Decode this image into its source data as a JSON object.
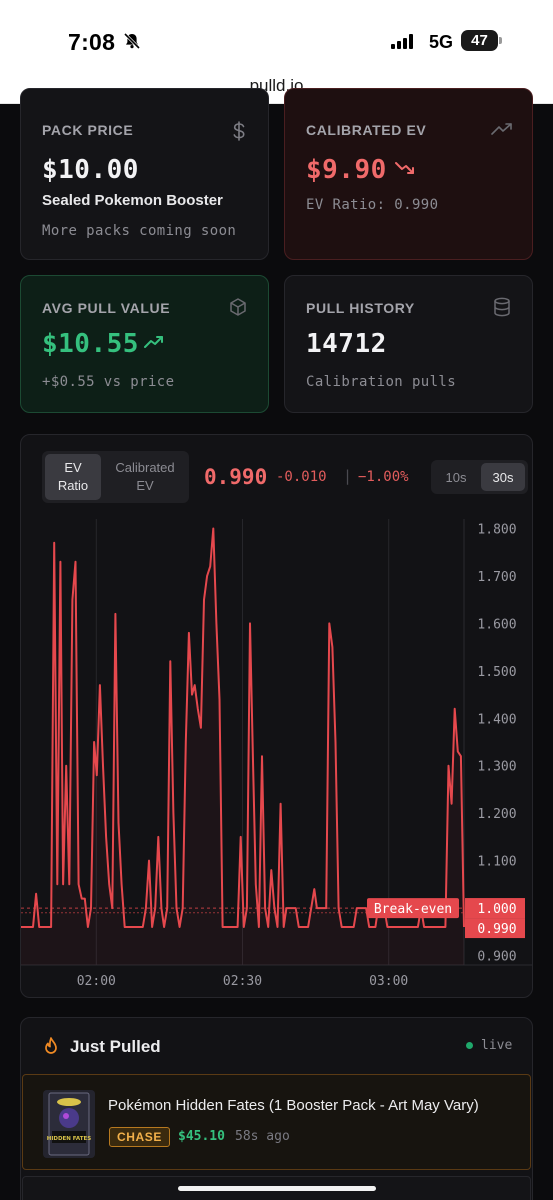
{
  "status_bar": {
    "time": "7:08",
    "network": "5G",
    "battery": "47"
  },
  "browser": {
    "url": "pulld.io"
  },
  "cards": {
    "pack_price": {
      "label": "PACK PRICE",
      "value": "$10.00",
      "product": "Sealed Pokemon Booster",
      "note": "More packs coming soon",
      "icon": "dollar-icon"
    },
    "calibrated_ev": {
      "label": "CALIBRATED EV",
      "value": "$9.90",
      "ratio": "EV Ratio: 0.990",
      "icon": "trend-up-icon",
      "trend_icon": "trend-down-icon"
    },
    "avg_pull": {
      "label": "AVG PULL VALUE",
      "value": "$10.55",
      "delta": "+$0.55 vs price",
      "icon": "box-icon",
      "trend_icon": "trend-up-icon"
    },
    "pull_history": {
      "label": "PULL HISTORY",
      "value": "14712",
      "note": "Calibration pulls",
      "icon": "database-icon"
    }
  },
  "chart_panel": {
    "toggle": {
      "ev_ratio": "EV\nRatio",
      "calibrated_ev": "Calibrated\nEV",
      "selected": "ev_ratio"
    },
    "current": "0.990",
    "change": "-0.010",
    "separator": "|",
    "change_pct": "−1.00%",
    "timeframes": [
      "10s",
      "30s"
    ],
    "selected_timeframe": "30s",
    "break_even_label": "Break-even",
    "colors": {
      "line": "#e5484d",
      "break_even": "#e5484d",
      "up": "#35c07e"
    }
  },
  "chart_data": {
    "type": "line",
    "x_ticks": [
      "02:00",
      "02:30",
      "03:00"
    ],
    "y_ticks": [
      "1.800",
      "1.700",
      "1.600",
      "1.500",
      "1.400",
      "1.300",
      "1.200",
      "1.100",
      "1.000",
      "0.900"
    ],
    "ylim": [
      0.88,
      1.82
    ],
    "xlim": [
      0,
      100
    ],
    "reference_lines": [
      {
        "label": "Break-even",
        "value": 1.0
      },
      {
        "label": "0.990",
        "value": 0.99
      }
    ],
    "series": [
      {
        "x": [
          0,
          2.7,
          3.4,
          4.1,
          4.8,
          6.8,
          7.5,
          8.2,
          8.9,
          9.5,
          10.2,
          10.9,
          11.6,
          12.3,
          13,
          13.7,
          14.4,
          15.1,
          15.8,
          16.5,
          17.1,
          17.8,
          18.5,
          19.2,
          19.9,
          20.6,
          21.3,
          22,
          22.7,
          23.4,
          24,
          24.7,
          25.4,
          26.1,
          26.8,
          27.5,
          28.2,
          28.9,
          29.6,
          30.3,
          31,
          31.7,
          32.3,
          33,
          33.7,
          34.4,
          35.1,
          35.8,
          36.5,
          37.2,
          37.9,
          38.6,
          39.2,
          39.9,
          40.6,
          41.3,
          42,
          42.7,
          43.4,
          44.1,
          44.8,
          45.5,
          46.1,
          46.8,
          47.5,
          48.2,
          48.9,
          49.6,
          50.3,
          51,
          51.7,
          52.4,
          53,
          53.7,
          54.4,
          55.1,
          55.8,
          56.5,
          57.2,
          57.9,
          58.6,
          59.3,
          59.9,
          60.6,
          61.3,
          62,
          62.7,
          63.4,
          64.1,
          64.8,
          65.5,
          66.2,
          66.8,
          67.5,
          68.2,
          68.9,
          69.6,
          70.3,
          71,
          71.7,
          72.4,
          73.1,
          73.7,
          74.4,
          75.1,
          75.8,
          76.5,
          77.2,
          77.9,
          78.6,
          79.3,
          80,
          80.6,
          81.3,
          82,
          82.7,
          83.4,
          84.1,
          84.8,
          85.5,
          86.2,
          86.9,
          87.5,
          88.2,
          88.9,
          89.6,
          90.3,
          91,
          91.7,
          92.4,
          93.1,
          93.8,
          94.4,
          95.1,
          95.8,
          96.5,
          97.2,
          97.9,
          98.6,
          99.3,
          100
        ],
        "values": [
          0.96,
          0.96,
          1.03,
          0.96,
          0.96,
          0.96,
          1.77,
          1.05,
          1.73,
          1.05,
          1.3,
          1.05,
          1.65,
          1.73,
          1.05,
          1.02,
          1.02,
          0.96,
          1.0,
          1.35,
          1.28,
          1.47,
          1.3,
          1.15,
          1.05,
          1.0,
          1.62,
          1.18,
          1.05,
          0.96,
          0.96,
          0.96,
          0.96,
          0.96,
          0.96,
          0.96,
          1.0,
          1.1,
          0.96,
          1.0,
          1.15,
          1.0,
          0.96,
          1.0,
          1.52,
          1.2,
          1.0,
          0.96,
          1.0,
          1.35,
          1.58,
          1.45,
          1.47,
          1.42,
          1.38,
          1.65,
          1.7,
          1.72,
          1.8,
          1.6,
          1.44,
          0.96,
          0.96,
          0.96,
          0.96,
          0.96,
          0.96,
          1.15,
          0.96,
          1.0,
          1.6,
          1.3,
          1.05,
          0.96,
          1.32,
          1.0,
          0.96,
          1.08,
          1.0,
          0.96,
          1.22,
          0.96,
          1.0,
          1.0,
          1.0,
          1.0,
          0.96,
          0.96,
          0.96,
          0.96,
          1.0,
          1.04,
          1.0,
          1.0,
          1.0,
          1.0,
          1.6,
          1.55,
          1.35,
          1.0,
          0.96,
          0.96,
          0.96,
          0.96,
          0.96,
          1.0,
          1.0,
          1.0,
          1.0,
          0.96,
          0.96,
          0.96,
          1.0,
          1.0,
          1.0,
          0.96,
          0.96,
          0.96,
          0.96,
          0.96,
          0.96,
          0.96,
          0.96,
          0.96,
          0.96,
          0.96,
          1.0,
          0.96,
          0.96,
          0.96,
          0.96,
          0.96,
          0.96,
          0.96,
          0.96,
          1.3,
          1.22,
          1.42,
          1.33,
          1.32,
          0.96
        ]
      }
    ],
    "grid": true,
    "legend": "none"
  },
  "just_pulled": {
    "title": "Just Pulled",
    "live_label": "live",
    "items": [
      {
        "name": "Pokémon Hidden Fates (1 Booster Pack - Art May Vary)",
        "badge": "CHASE",
        "price": "$45.10",
        "ago": "58s ago",
        "thumb_text": "HIDDEN FATES"
      }
    ]
  }
}
